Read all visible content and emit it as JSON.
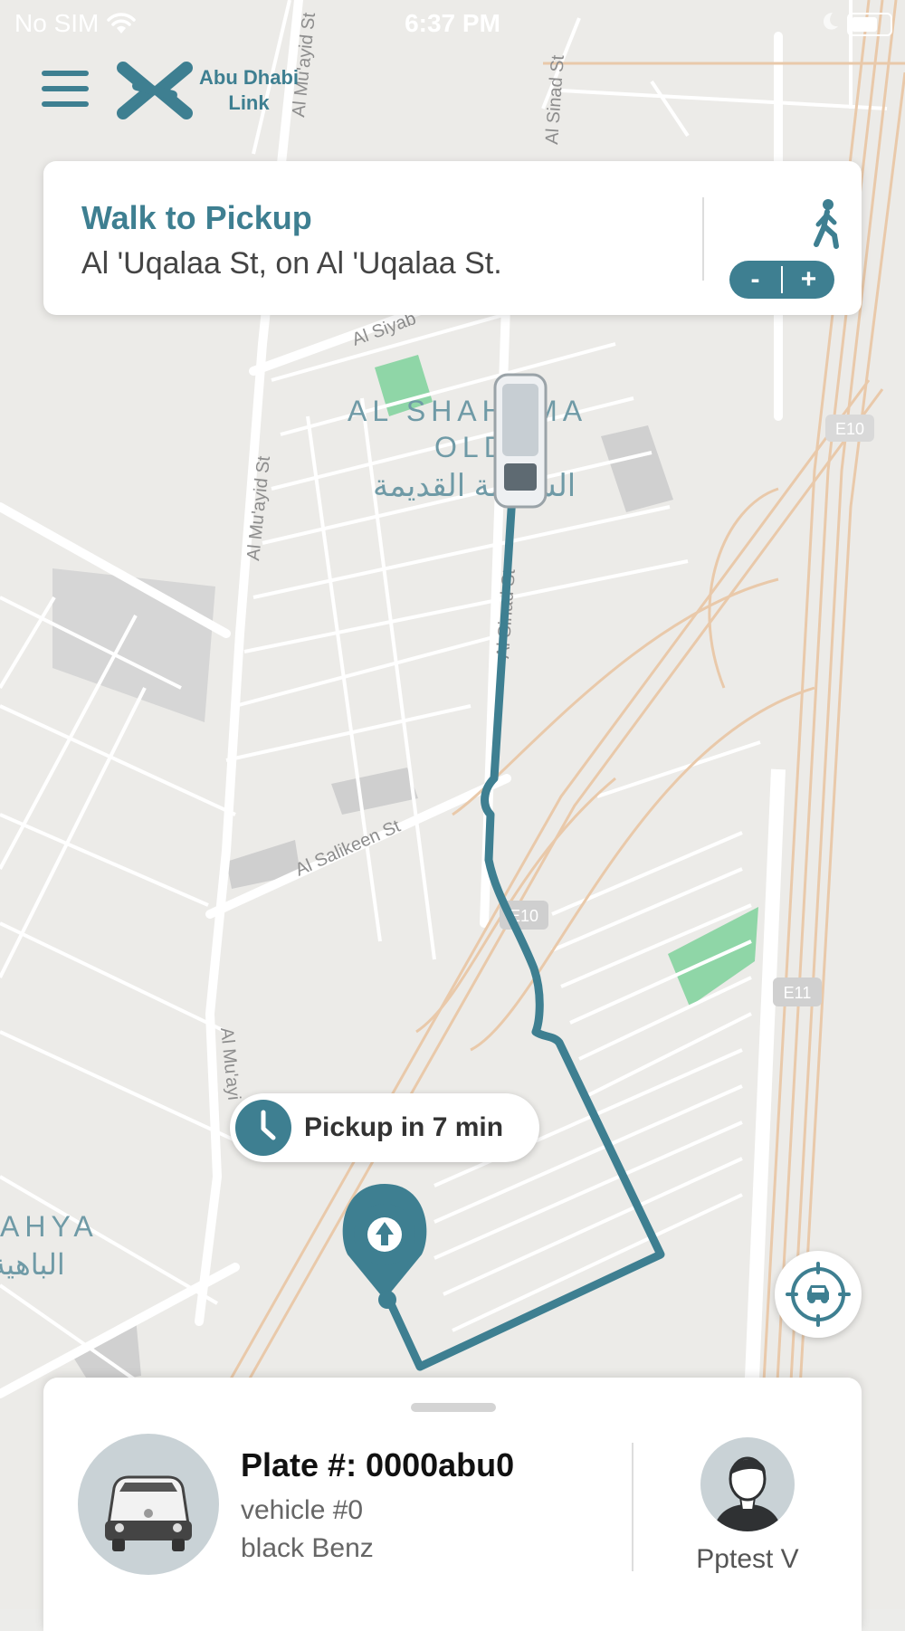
{
  "status_bar": {
    "carrier": "No SIM",
    "time": "6:37 PM"
  },
  "app": {
    "logo_line1": "Abu Dhabi",
    "logo_line2": "Link"
  },
  "route_card": {
    "title": "Walk to Pickup",
    "subtitle": "Al 'Uqalaa St, on Al 'Uqalaa St.",
    "zoom_minus": "-",
    "zoom_plus": "+"
  },
  "map": {
    "district_en_line1": "AL SHAHAMA",
    "district_en_line2": "OLD",
    "district_ar": "الشهامة القديمة",
    "partial_label_en": "AHYA",
    "partial_label_ar": "الباهية",
    "streets": {
      "al_siyab": "Al Siyab",
      "al_muayid": "Al Mu'ayid St",
      "al_muayid_short": "Al Mu'ayi",
      "al_sinad": "Al Sinad St",
      "al_salikeen": "Al Salikeen St",
      "e10": "E10",
      "e11": "E11"
    }
  },
  "eta": {
    "text": "Pickup in 7 min"
  },
  "vehicle": {
    "plate": "Plate #: 0000abu0",
    "name": "vehicle #0",
    "color": "black Benz"
  },
  "driver": {
    "name": "Pptest V"
  },
  "colors": {
    "accent": "#3e7f91",
    "park": "#8fd6a7",
    "highway": "#e9c9aa"
  }
}
